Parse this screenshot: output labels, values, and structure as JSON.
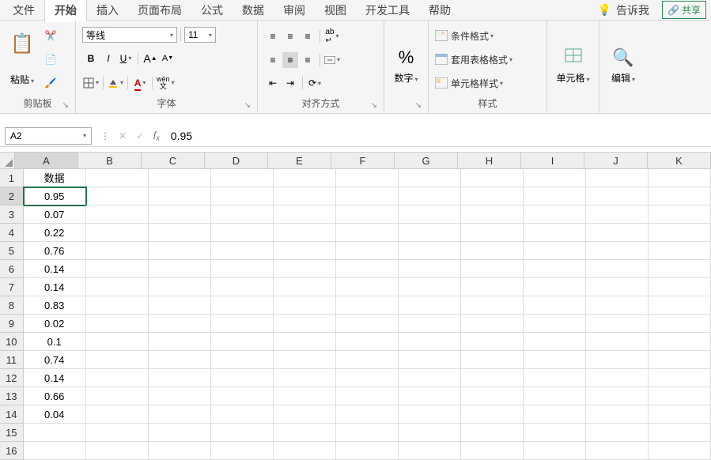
{
  "tabs": {
    "file": "文件",
    "home": "开始",
    "insert": "插入",
    "layout": "页面布局",
    "formula": "公式",
    "data": "数据",
    "review": "审阅",
    "view": "视图",
    "dev": "开发工具",
    "help": "帮助",
    "tellme": "告诉我",
    "share": "共享"
  },
  "ribbon": {
    "clipboard": {
      "paste": "粘贴",
      "label": "剪贴板"
    },
    "font": {
      "name": "等线",
      "size": "11",
      "label": "字体"
    },
    "align": {
      "label": "对齐方式"
    },
    "number": {
      "btn": "数字",
      "label": ""
    },
    "styles": {
      "cond": "条件格式",
      "table": "套用表格格式",
      "cell": "单元格样式",
      "label": "样式"
    },
    "cells": {
      "btn": "单元格"
    },
    "editing": {
      "btn": "编辑"
    }
  },
  "namebox": "A2",
  "formula": "0.95",
  "columns": [
    "A",
    "B",
    "C",
    "D",
    "E",
    "F",
    "G",
    "H",
    "I",
    "J",
    "K"
  ],
  "rows": [
    {
      "n": 1,
      "a": "数据"
    },
    {
      "n": 2,
      "a": "0.95",
      "sel": true
    },
    {
      "n": 3,
      "a": "0.07"
    },
    {
      "n": 4,
      "a": "0.22"
    },
    {
      "n": 5,
      "a": "0.76"
    },
    {
      "n": 6,
      "a": "0.14"
    },
    {
      "n": 7,
      "a": "0.14"
    },
    {
      "n": 8,
      "a": "0.83"
    },
    {
      "n": 9,
      "a": "0.02"
    },
    {
      "n": 10,
      "a": "0.1"
    },
    {
      "n": 11,
      "a": "0.74"
    },
    {
      "n": 12,
      "a": "0.14"
    },
    {
      "n": 13,
      "a": "0.66"
    },
    {
      "n": 14,
      "a": "0.04"
    },
    {
      "n": 15,
      "a": ""
    },
    {
      "n": 16,
      "a": ""
    }
  ]
}
